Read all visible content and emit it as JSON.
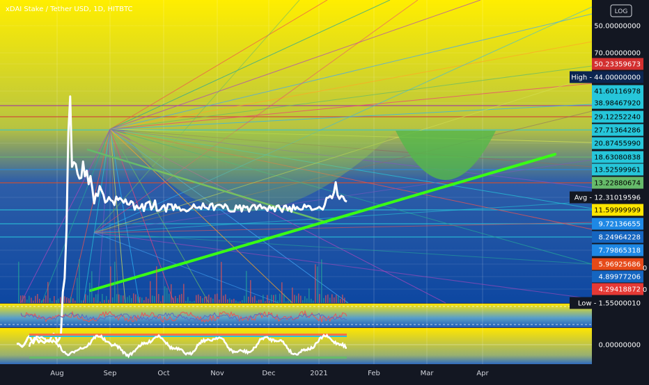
{
  "chart_data": {
    "type": "line",
    "title": "xDAI Stake / Tether USD, 1D, HITBTC",
    "log_label": "LOG",
    "series": [
      {
        "values": [
          2.35,
          2.36,
          2.32,
          2.28,
          2.33,
          2.41,
          2.52,
          2.57,
          2.45,
          2.37,
          2.49,
          2.48,
          2.39,
          2.45,
          2.41,
          2.38,
          2.44,
          2.45,
          2.44,
          2.58,
          2.63,
          2.56,
          2.41,
          2.48,
          2.65,
          4.16,
          4.83,
          8.19,
          23.73,
          35.58,
          16.44,
          17.3,
          16.97,
          15.22,
          14.46,
          14.55,
          17.42,
          14.81,
          15.77,
          13.58,
          14.86,
          12.93,
          10.99,
          12.25,
          11.94,
          13.3,
          12.69,
          12.1,
          11.11,
          11.3,
          11.78,
          11.4,
          11.27,
          10.81,
          11.85,
          11.43,
          11.68,
          11.43,
          11.09,
          11.5,
          10.91,
          10.86,
          11.28,
          11.13,
          10.26,
          10.74,
          10.42,
          10.46,
          10.92,
          10.12,
          10.98,
          11.12,
          11.24,
          10.28,
          10.65,
          11.37,
          10.16,
          10.16,
          10.28,
          10.61,
          10.79,
          10.05,
          10.91,
          10.89,
          10.88,
          10.22,
          10.86,
          10.44,
          10.55,
          10.16,
          10.3,
          10.26,
          10.08,
          10.16,
          10.35,
          10.5,
          10.88,
          10.51,
          10.47,
          10.58,
          10.35,
          11.0,
          10.53,
          10.48,
          10.32,
          10.88,
          10.99,
          10.23,
          10.69,
          10.82,
          10.84,
          10.76,
          10.45,
          10.9,
          10.67,
          10.16,
          10.06,
          10.07,
          10.07,
          10.75,
          10.43,
          10.78,
          10.07,
          10.73,
          10.52,
          10.61,
          10.05,
          10.52,
          10.79,
          10.81,
          10.28,
          10.69,
          10.84,
          10.43,
          10.56,
          10.43,
          10.14,
          10.69,
          10.39,
          10.58,
          10.09,
          10.7,
          10.76,
          10.33,
          10.02,
          10.68,
          10.74,
          10.19,
          10.58,
          10.04,
          10.81,
          10.3,
          10.58,
          10.35,
          10.28,
          10.31,
          10.86,
          10.56,
          10.72,
          10.66,
          10.24,
          10.29,
          10.36,
          10.44,
          10.59,
          10.42,
          10.28,
          10.79,
          11.69,
          11.73,
          11.95,
          11.65,
          12.39,
          13.88,
          12.06,
          11.57,
          11.95,
          11.83,
          11.34,
          11.21
        ]
      }
    ],
    "x_labels": [
      "Aug",
      "Sep",
      "Oct",
      "Nov",
      "Dec",
      "2021",
      "Feb",
      "Mar",
      "Apr"
    ],
    "price_labels": [
      {
        "text": "50.00000000",
        "bg": "",
        "fg": "#ffffff"
      },
      {
        "text": "70.00000000",
        "bg": "",
        "fg": "#ffffff"
      },
      {
        "text": "50.23359673",
        "bg": "#d32f2f",
        "fg": "#ffffff"
      },
      {
        "text": "High - 44.00000000",
        "bg": "#0c2550",
        "fg": "#ffffff"
      },
      {
        "text": "41.60116978",
        "bg": "#26c6da",
        "fg": "#000000"
      },
      {
        "text": "38.98467920",
        "bg": "#26c6da",
        "fg": "#000000"
      },
      {
        "text": "29.12252240",
        "bg": "#26c6da",
        "fg": "#000000"
      },
      {
        "text": "27.71364286",
        "bg": "#26c6da",
        "fg": "#000000"
      },
      {
        "text": "20.87455990",
        "bg": "#26c6da",
        "fg": "#000000"
      },
      {
        "text": "18.63080838",
        "bg": "#26c6da",
        "fg": "#000000"
      },
      {
        "text": "13.52599961",
        "bg": "#26c6da",
        "fg": "#000000"
      },
      {
        "text": "13.22880674",
        "bg": "#66bb6a",
        "fg": "#000000"
      },
      {
        "text": "Avg - 12.31019596",
        "bg": "#131722",
        "fg": "#ffffff"
      },
      {
        "text": "11.59999999",
        "bg": "#ffe600",
        "fg": "#000000"
      },
      {
        "text": "9.72136655",
        "bg": "#1e88e5",
        "fg": "#ffffff"
      },
      {
        "text": "8.24964228",
        "bg": "#1565c0",
        "fg": "#ffffff"
      },
      {
        "text": "7.79865318",
        "bg": "#1e88e5",
        "fg": "#ffffff"
      },
      {
        "text": "5.96925686",
        "bg": "#e64a19",
        "fg": "#ffffff"
      },
      {
        "text": "4.89977206",
        "bg": "#1565c0",
        "fg": "#ffffff"
      },
      {
        "text": "4.29418872",
        "bg": "#e53935",
        "fg": "#ffffff"
      },
      {
        "text": "Low - 1.55000010",
        "bg": "#131722",
        "fg": "#ffffff"
      },
      {
        "text": "0.00000000",
        "bg": "",
        "fg": "#ffffff"
      }
    ],
    "side_marks": [
      "0",
      "0"
    ],
    "log_scale": true,
    "grid": true,
    "ylim": [
      1.55,
      70
    ]
  }
}
